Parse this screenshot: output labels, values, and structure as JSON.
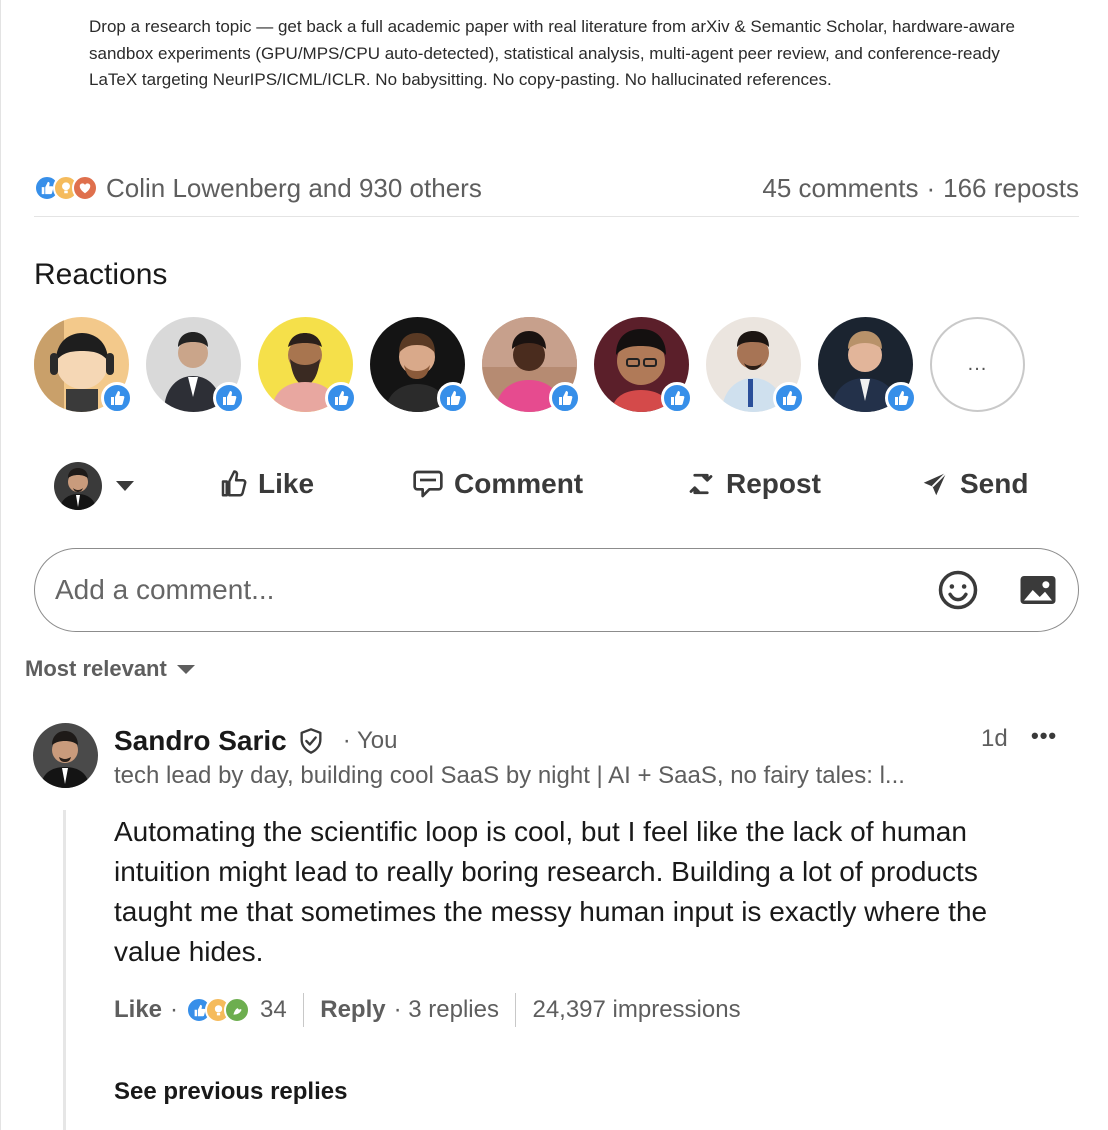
{
  "post": {
    "text": "Drop a research topic — get back a full academic paper with real literature from arXiv & Semantic Scholar, hardware-aware sandbox experiments (GPU/MPS/CPU auto-detected), statistical analysis, multi-agent peer review, and conference-ready LaTeX targeting NeurIPS/ICML/ICLR. No babysitting. No copy-pasting. No hallucinated references."
  },
  "social": {
    "reactors_label": "Colin Lowenberg and 930 others",
    "comments_label": "45 comments",
    "separator": "·",
    "reposts_label": "166 reposts",
    "reaction_icons": [
      "like-icon",
      "insightful-icon",
      "love-icon"
    ]
  },
  "reactions": {
    "title": "Reactions",
    "more_label": "...",
    "people_count": 8
  },
  "actions": {
    "like": "Like",
    "comment": "Comment",
    "repost": "Repost",
    "send": "Send"
  },
  "comment_box": {
    "placeholder": "Add a comment..."
  },
  "sort": {
    "label": "Most relevant"
  },
  "comment": {
    "author": "Sandro Saric",
    "you_label": "· You",
    "time": "1d",
    "more": "•••",
    "headline": "tech lead by day, building cool SaaS by night | AI + SaaS, no fairy tales: l...",
    "body": "Automating the scientific loop is cool, but I feel like the lack of human intuition might lead to really boring research. Building a lot of products taught me that sometimes the messy human input is exactly where the value hides.",
    "like_label": "Like",
    "dot": "·",
    "reaction_count": "34",
    "reply_label": "Reply",
    "replies_label": "· 3 replies",
    "impressions_label": "24,397 impressions",
    "see_previous": "See previous replies"
  },
  "colors": {
    "like": "#378fe9",
    "insightful": "#f5bb5c",
    "love": "#df704d",
    "support": "#6dae4f"
  }
}
